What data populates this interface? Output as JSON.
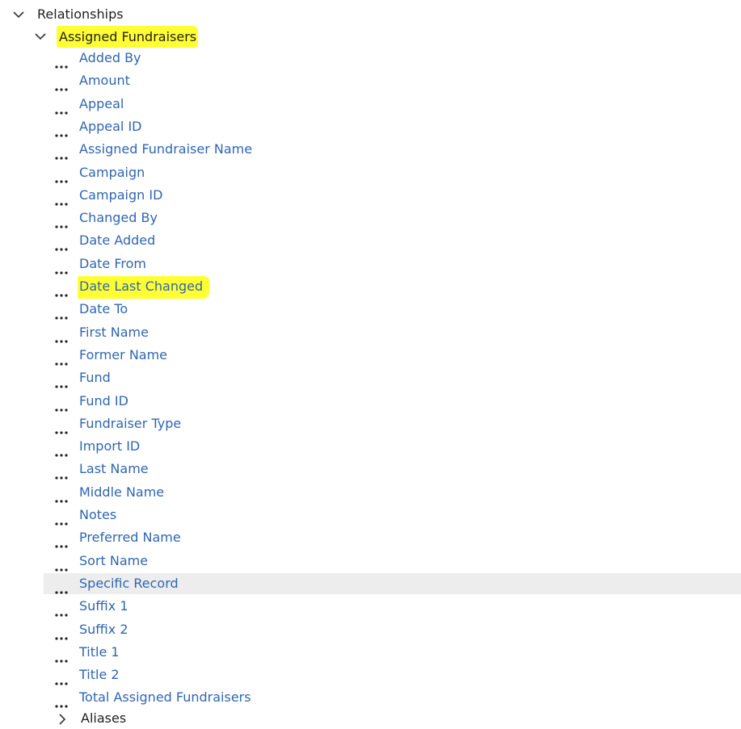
{
  "tree": {
    "root": {
      "label": "Relationships",
      "expanded": true
    },
    "group": {
      "label": "Assigned Fundraisers",
      "expanded": true,
      "highlight_color": "#ffff33"
    },
    "fields": [
      {
        "label": "Added By"
      },
      {
        "label": "Amount"
      },
      {
        "label": "Appeal"
      },
      {
        "label": "Appeal ID"
      },
      {
        "label": "Assigned Fundraiser Name"
      },
      {
        "label": "Campaign"
      },
      {
        "label": "Campaign ID"
      },
      {
        "label": "Changed By"
      },
      {
        "label": "Date Added"
      },
      {
        "label": "Date From"
      },
      {
        "label": "Date Last Changed",
        "highlighted": true
      },
      {
        "label": "Date To"
      },
      {
        "label": "First Name"
      },
      {
        "label": "Former Name"
      },
      {
        "label": "Fund"
      },
      {
        "label": "Fund ID"
      },
      {
        "label": "Fundraiser Type"
      },
      {
        "label": "Import ID"
      },
      {
        "label": "Last Name"
      },
      {
        "label": "Middle Name"
      },
      {
        "label": "Notes"
      },
      {
        "label": "Preferred Name"
      },
      {
        "label": "Sort Name"
      },
      {
        "label": "Specific Record",
        "selected": true
      },
      {
        "label": "Suffix 1"
      },
      {
        "label": "Suffix 2"
      },
      {
        "label": "Title 1"
      },
      {
        "label": "Title 2"
      },
      {
        "label": "Total Assigned Fundraisers"
      }
    ],
    "next_group": {
      "label": "Aliases",
      "expanded": false
    }
  },
  "colors": {
    "link_text": "#2f66b0",
    "header_text": "#1f1f1f",
    "selected_row_bg": "#ededed",
    "highlight": "#ffff33"
  },
  "icons": {
    "expanded": "chevron-down-icon",
    "collapsed": "chevron-right-icon",
    "field": "more-dots-icon"
  }
}
